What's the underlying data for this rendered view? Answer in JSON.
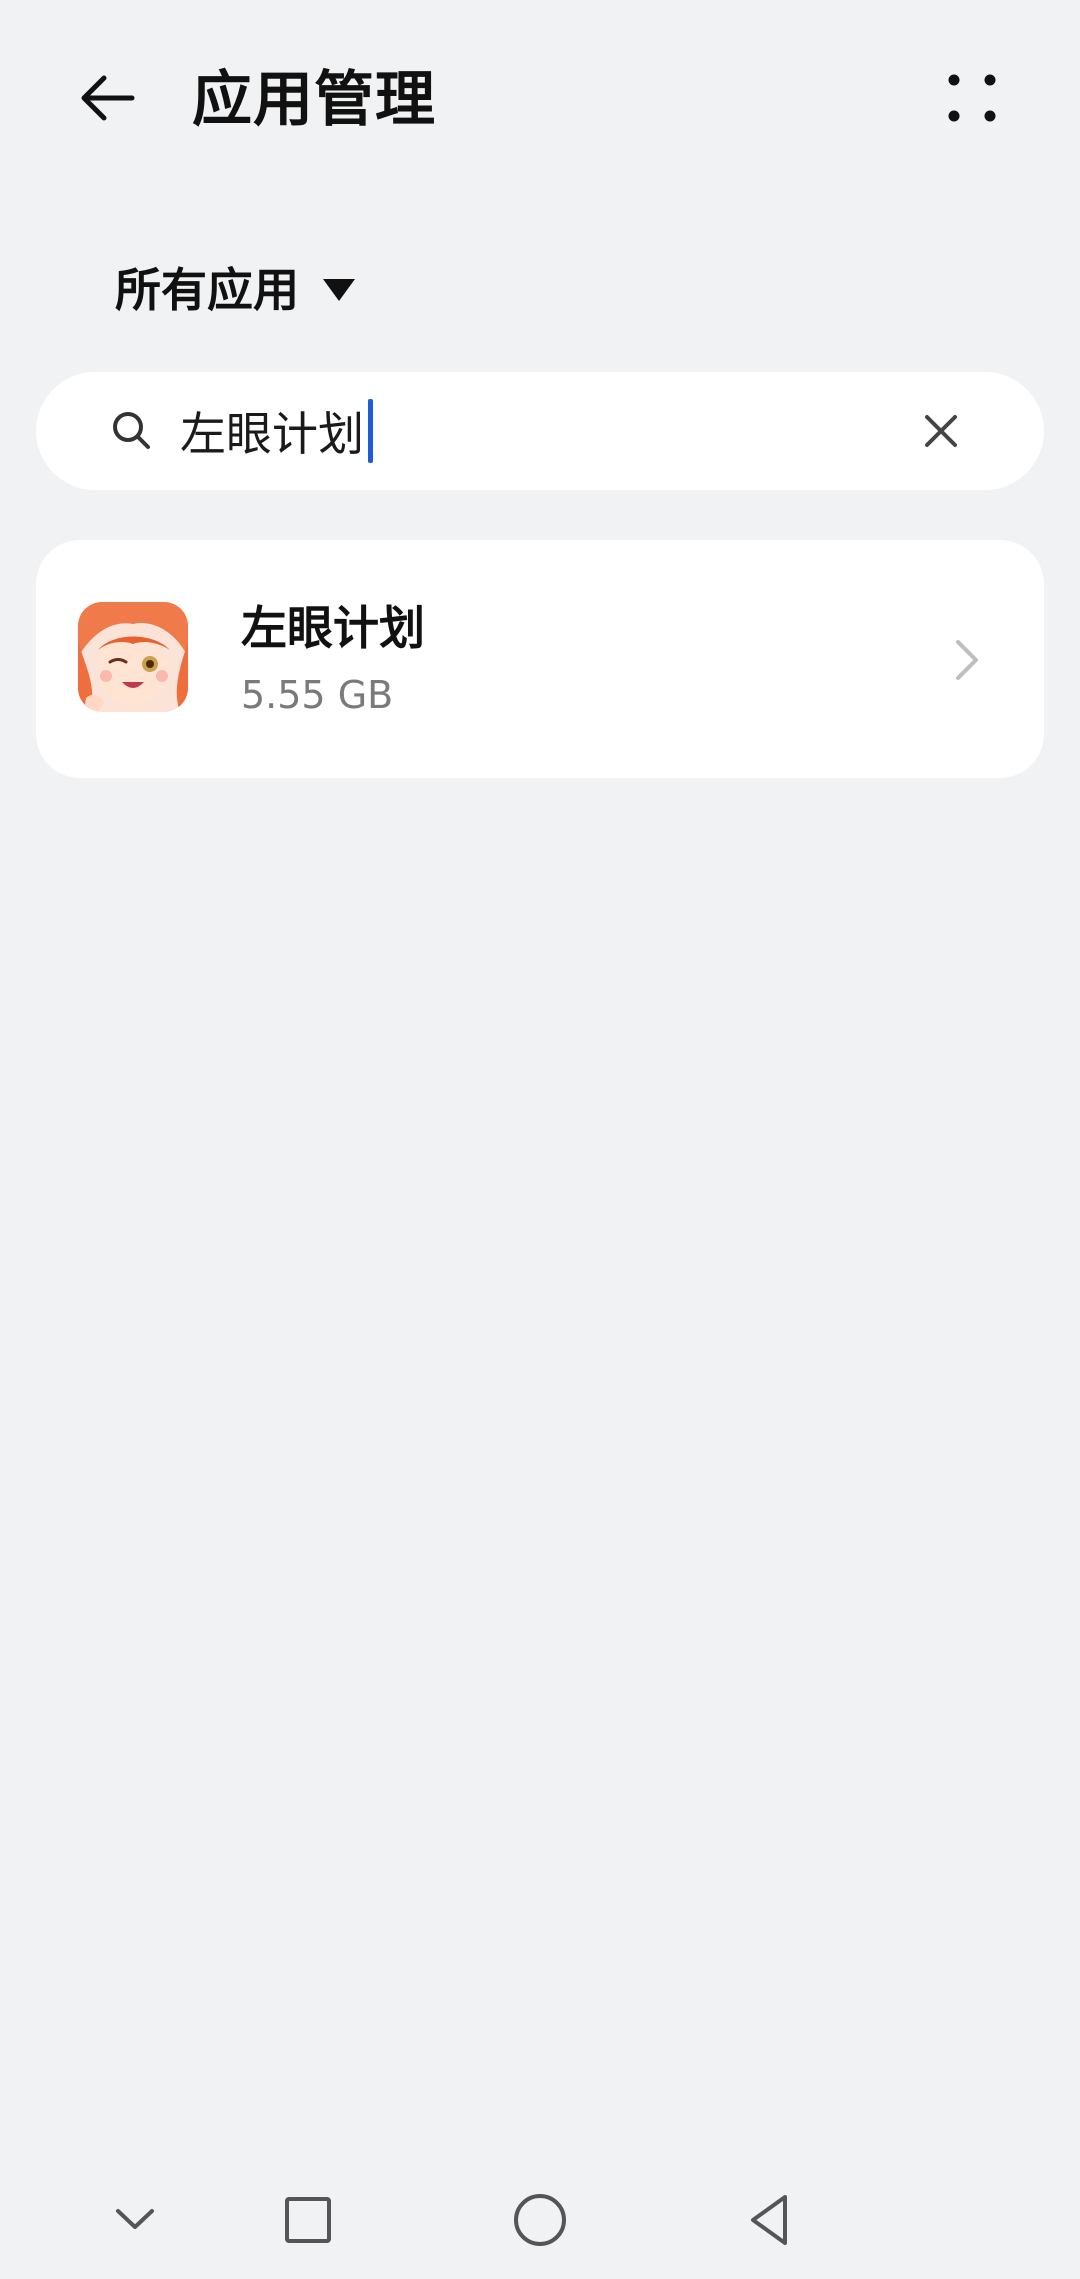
{
  "header": {
    "title": "应用管理",
    "back_icon": "arrow-left-icon",
    "more_icon": "more-dots-icon"
  },
  "filter": {
    "label": "所有应用",
    "caret_icon": "caret-down-icon"
  },
  "search": {
    "value": "左眼计划",
    "search_icon": "search-icon",
    "clear_icon": "close-icon",
    "caret_color": "#1e5bd6"
  },
  "apps": [
    {
      "name": "左眼计划",
      "size": "5.55 GB",
      "icon": "app-avatar-icon",
      "chevron": "chevron-right-icon"
    }
  ],
  "navbar": {
    "items": [
      "chevron-down-icon",
      "square-icon",
      "circle-icon",
      "triangle-back-icon"
    ]
  },
  "colors": {
    "background": "#f1f2f4",
    "surface": "#ffffff",
    "accent": "#1e5bd6",
    "secondary_text": "#7a7a7a"
  }
}
